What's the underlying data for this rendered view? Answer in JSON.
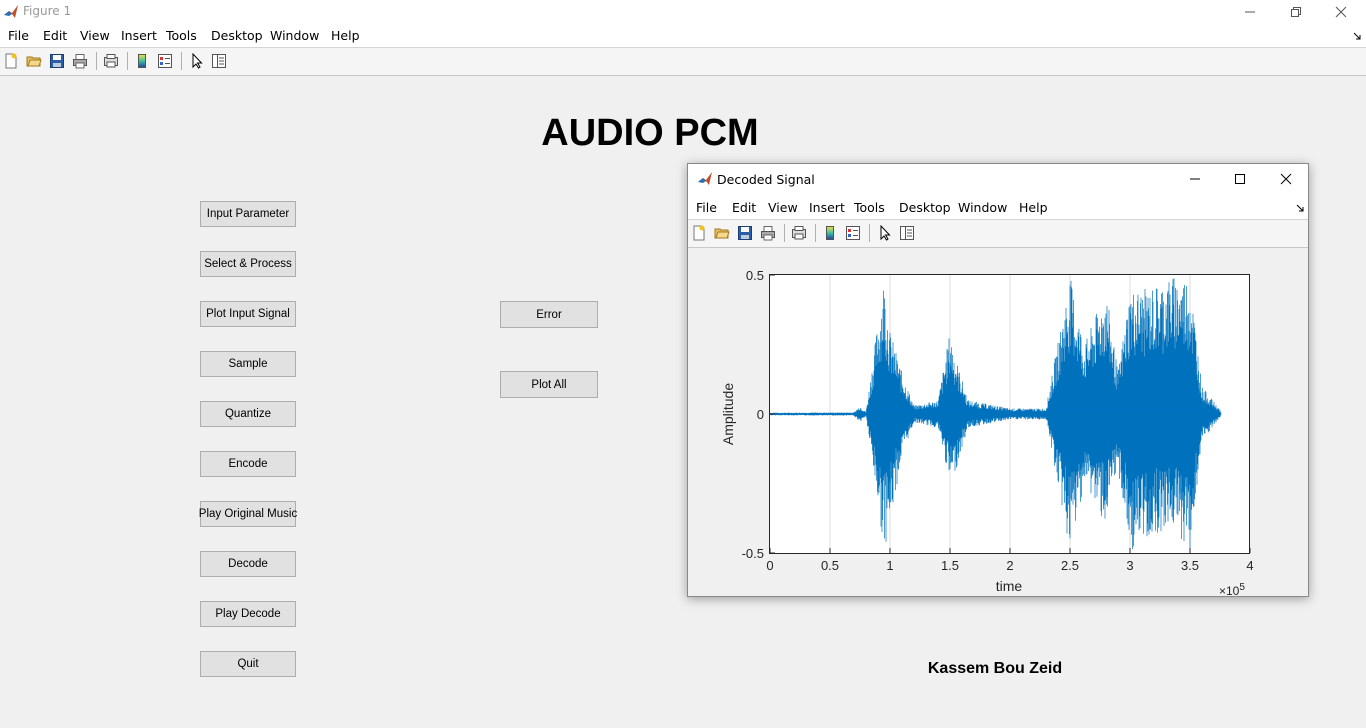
{
  "main_window": {
    "title": "Figure 1",
    "menu": [
      "File",
      "Edit",
      "View",
      "Insert",
      "Tools",
      "Desktop",
      "Window",
      "Help"
    ],
    "toolbar_icons": [
      "new-file-icon",
      "open-folder-icon",
      "save-icon",
      "print-icon",
      "link-print-icon",
      "colorbar-icon",
      "legend-icon",
      "pointer-icon",
      "property-inspector-icon"
    ]
  },
  "heading": "AUDIO PCM",
  "buttons": {
    "input_parameter": "Input Parameter",
    "select_process": "Select & Process",
    "plot_input_signal": "Plot Input Signal",
    "sample": "Sample",
    "quantize": "Quantize",
    "encode": "Encode",
    "play_original_music": "Play Original Music",
    "decode": "Decode",
    "play_decode": "Play Decode",
    "quit": "Quit",
    "error": "Error",
    "plot_all": "Plot All"
  },
  "author": "Kassem Bou Zeid",
  "child_window": {
    "title": "Decoded Signal",
    "menu": [
      "File",
      "Edit",
      "View",
      "Insert",
      "Tools",
      "Desktop",
      "Window",
      "Help"
    ]
  },
  "colors": {
    "signal": "#0072BD",
    "background": "#f0f0f0"
  },
  "chart_data": {
    "type": "line",
    "title": "",
    "xlabel": "time",
    "ylabel": "Amplitude",
    "xlim": [
      0,
      400000
    ],
    "ylim": [
      -0.5,
      0.5
    ],
    "x_ticks": [
      "0",
      "0.5",
      "1",
      "1.5",
      "2",
      "2.5",
      "3",
      "3.5",
      "4"
    ],
    "y_ticks": [
      "-0.5",
      "0",
      "0.5"
    ],
    "x_exponent_base": "×10",
    "x_exponent_power": "5",
    "grid": "vertical",
    "series": [
      {
        "color": "#0072BD",
        "envelope": [
          {
            "x": 0,
            "max": 0.005,
            "min": -0.005
          },
          {
            "x": 70000,
            "max": 0.006,
            "min": -0.006
          },
          {
            "x": 75000,
            "max": 0.03,
            "min": -0.03
          },
          {
            "x": 80000,
            "max": 0.008,
            "min": -0.008
          },
          {
            "x": 95000,
            "max": 0.5,
            "min": -0.49
          },
          {
            "x": 100000,
            "max": 0.3,
            "min": -0.4
          },
          {
            "x": 110000,
            "max": 0.15,
            "min": -0.15
          },
          {
            "x": 120000,
            "max": 0.03,
            "min": -0.03
          },
          {
            "x": 140000,
            "max": 0.05,
            "min": -0.05
          },
          {
            "x": 150000,
            "max": 0.3,
            "min": -0.25
          },
          {
            "x": 155000,
            "max": 0.2,
            "min": -0.2
          },
          {
            "x": 165000,
            "max": 0.05,
            "min": -0.05
          },
          {
            "x": 200000,
            "max": 0.02,
            "min": -0.02
          },
          {
            "x": 230000,
            "max": 0.02,
            "min": -0.02
          },
          {
            "x": 250000,
            "max": 0.5,
            "min": -0.5
          },
          {
            "x": 262000,
            "max": 0.25,
            "min": -0.25
          },
          {
            "x": 280000,
            "max": 0.45,
            "min": -0.4
          },
          {
            "x": 290000,
            "max": 0.15,
            "min": -0.2
          },
          {
            "x": 300000,
            "max": 0.45,
            "min": -0.5
          },
          {
            "x": 315000,
            "max": 0.45,
            "min": -0.45
          },
          {
            "x": 335000,
            "max": 0.5,
            "min": -0.4
          },
          {
            "x": 350000,
            "max": 0.5,
            "min": -0.5
          },
          {
            "x": 360000,
            "max": 0.1,
            "min": -0.1
          },
          {
            "x": 375000,
            "max": 0.015,
            "min": -0.015
          },
          {
            "x": 376000,
            "max": 0,
            "min": 0
          }
        ]
      }
    ]
  }
}
